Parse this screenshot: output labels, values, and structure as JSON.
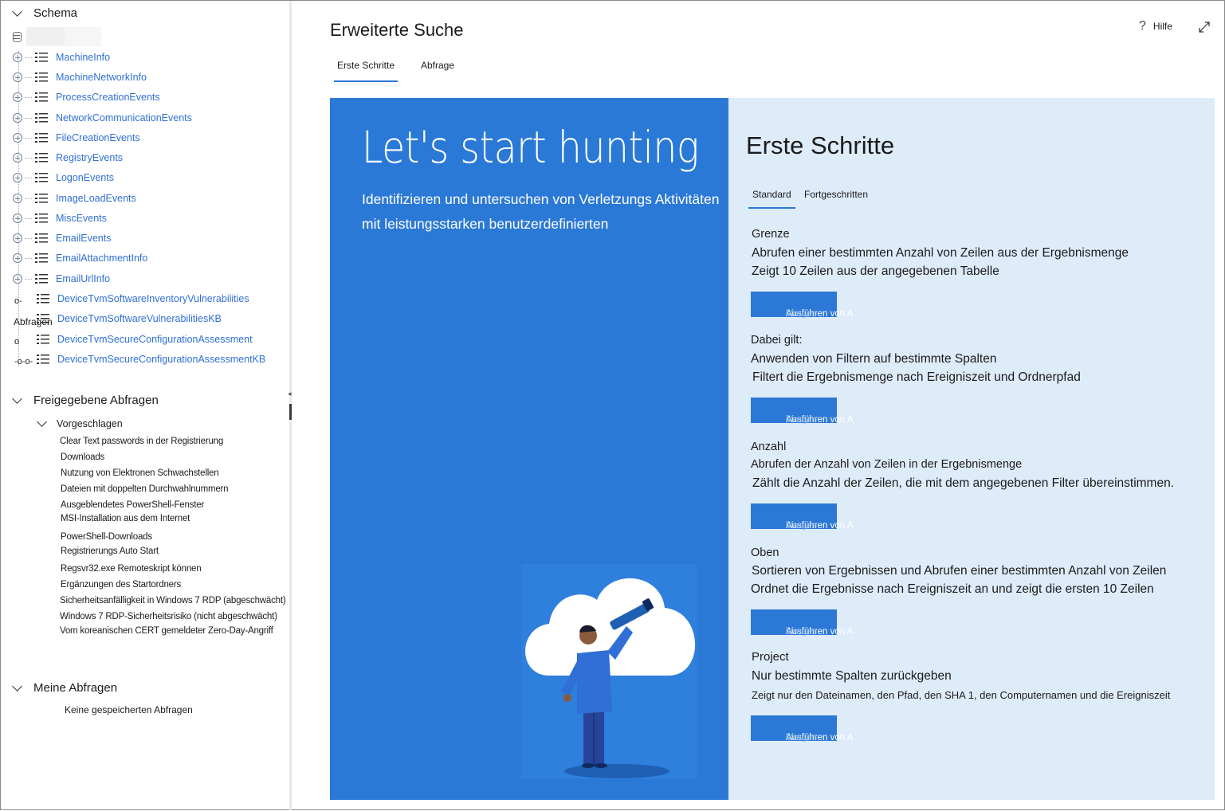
{
  "sidebar": {
    "schema": {
      "title": "Schema",
      "tables": [
        "MachineInfo",
        "MachineNetworkInfo",
        "ProcessCreationEvents",
        "NetworkCommunicationEvents",
        "FileCreationEvents",
        "RegistryEvents",
        "LogonEvents",
        "ImageLoadEvents",
        "MiscEvents",
        "EmailEvents",
        "EmailAttachmentInfo",
        "EmailUrlInfo",
        "DeviceTvmSoftwareInventoryVulnerabilities",
        "DeviceTvmSoftwareVulnerabilitiesKB",
        "DeviceTvmSecureConfigurationAssessment",
        "DeviceTvmSecureConfigurationAssessmentKB"
      ],
      "overlay_texts": [
        "o-",
        "Abfragen",
        "o",
        "-o-o-"
      ]
    },
    "shared": {
      "title": "Freigegebene Abfragen",
      "suggested_title": "Vorgeschlagen",
      "queries": [
        "Clear Text passwords in der Registrierung",
        "Downloads",
        "Nutzung von Elektronen Schwachstellen",
        "Dateien mit doppelten Durchwahlnummern",
        "Ausgeblendetes PowerShell-Fenster",
        "MSI-Installation aus dem Internet",
        "PowerShell-Downloads",
        "Registrierungs Auto Start",
        "Regsvr32.exe Remoteskript können",
        "Ergänzungen des Startordners",
        "Sicherheitsanfälligkeit in Windows 7 RDP (abgeschwächt)",
        "Windows 7 RDP-Sicherheitsrisiko (nicht abgeschwächt)",
        "Vom koreanischen CERT gemeldeter Zero-Day-Angriff"
      ]
    },
    "mine": {
      "title": "Meine Abfragen",
      "empty_text": "Keine gespeicherten Abfragen"
    }
  },
  "header": {
    "title": "Erweiterte Suche",
    "help_label": "Hilfe",
    "tabs": [
      "Erste Schritte",
      "Abfrage"
    ]
  },
  "hero": {
    "title": "Let's start hunting",
    "description_line1": "Identifizieren und untersuchen von Verletzungs Aktivitäten",
    "description_line2": "mit leistungsstarken benutzerdefinierten"
  },
  "getting_started": {
    "title": "Erste Schritte",
    "tabs": [
      "Standard",
      "Fortgeschritten"
    ],
    "run_button_main": "Ausführen von A",
    "run_button_rest": "bfragen",
    "sections": [
      {
        "heading": "Grenze",
        "line1": "Abrufen einer bestimmten Anzahl von Zeilen aus der Ergebnismenge",
        "line2": "Zeigt 10 Zeilen aus der angegebenen Tabelle"
      },
      {
        "heading": "Dabei gilt:",
        "line1": "Anwenden von Filtern auf bestimmte Spalten",
        "line2": "Filtert die Ergebnismenge nach Ereigniszeit und Ordnerpfad"
      },
      {
        "heading": "Anzahl",
        "line1": "Abrufen der Anzahl von Zeilen in der Ergebnismenge",
        "line2": "Zählt die Anzahl der Zeilen, die mit dem angegebenen Filter übereinstimmen."
      },
      {
        "heading": "Oben",
        "line1": "Sortieren von Ergebnissen und Abrufen einer bestimmten Anzahl von Zeilen",
        "line2": "Ordnet die Ergebnisse nach Ereigniszeit an und zeigt die ersten 10 Zeilen"
      },
      {
        "heading": "Project",
        "line1": "Nur bestimmte Spalten zurückgeben",
        "line2": "Zeigt nur den Dateinamen, den Pfad, den SHA 1, den Computernamen und die Ereigniszeit"
      }
    ]
  },
  "colors": {
    "accent": "#2b78d6",
    "hero_bg": "#2b79d6",
    "panel_bg": "#deebf9",
    "link": "#2f6fd6"
  }
}
